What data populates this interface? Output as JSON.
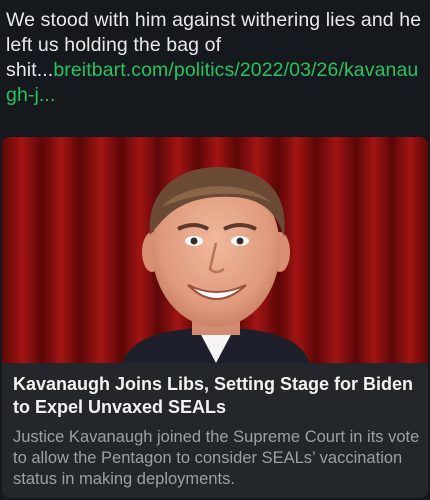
{
  "post": {
    "text": "We stood with him against withering lies and he left us holding the bag of shit...",
    "link_text": "breitbart.com/politics/2022/03/26/kavanaugh-j..."
  },
  "card": {
    "image_alt": "Brett Kavanaugh",
    "title": "Kavanaugh Joins Libs, Setting Stage for Biden to Expel Unvaxed SEALs",
    "description": "Justice Kavanaugh joined the Supreme Court in its vote to allow the Pentagon to consider SEALs’ vaccination status in making deployments."
  },
  "colors": {
    "background": "#15181c",
    "text": "#e7e9ea",
    "link": "#22c55e",
    "card_bg": "#23272b",
    "card_desc": "#9aa0a6"
  }
}
